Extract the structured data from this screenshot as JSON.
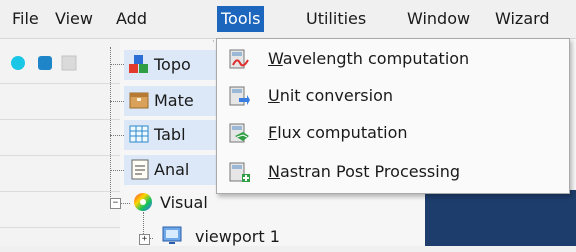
{
  "menubar": {
    "items": [
      "File",
      "View",
      "Add",
      "Tools",
      "Utilities",
      "Window",
      "Wizard"
    ],
    "active": "Tools"
  },
  "tree": {
    "nodes": {
      "topo": "Topo",
      "materials": "Mate",
      "tables": "Tabl",
      "analysis": "Anal",
      "visual": "Visual",
      "viewport": "viewport 1"
    }
  },
  "tools_menu": {
    "items": [
      {
        "label": "Wavelength computation",
        "icon": "wavelength-icon"
      },
      {
        "label": "Unit conversion",
        "icon": "unit-conversion-icon"
      },
      {
        "label": "Flux computation",
        "icon": "flux-computation-icon"
      },
      {
        "label": "Nastran Post Processing",
        "icon": "nastran-post-processing-icon"
      }
    ]
  },
  "colors": {
    "menu_highlight": "#1c66bd",
    "viewport_background": "#1d3d6c"
  }
}
